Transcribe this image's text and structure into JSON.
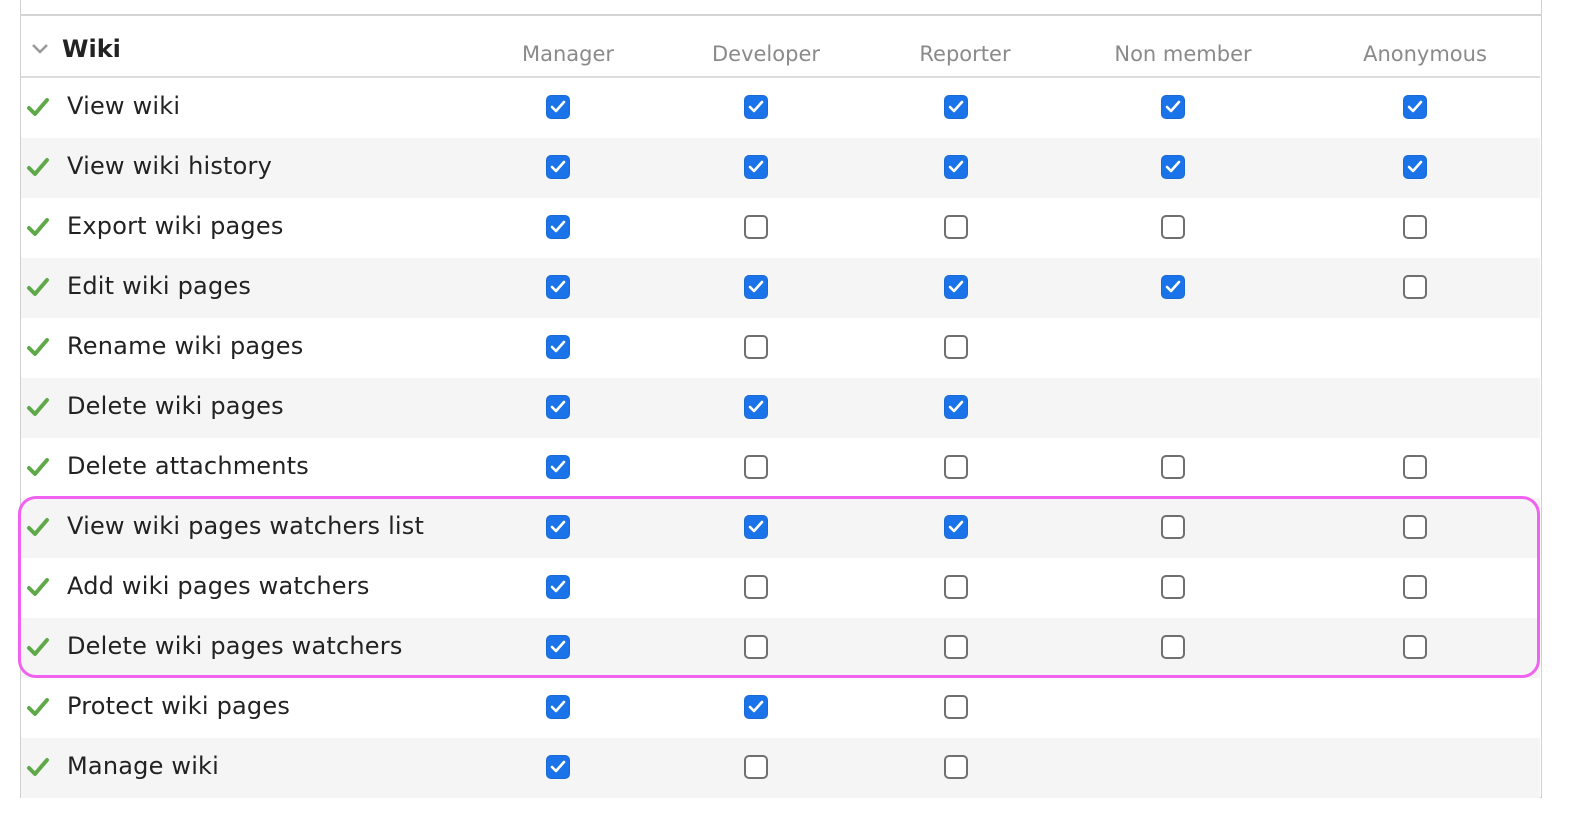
{
  "section": {
    "title": "Wiki"
  },
  "columns": [
    "Manager",
    "Developer",
    "Reporter",
    "Non member",
    "Anonymous"
  ],
  "permissions": [
    {
      "label": "View wiki",
      "values": [
        true,
        true,
        true,
        true,
        true
      ]
    },
    {
      "label": "View wiki history",
      "values": [
        true,
        true,
        true,
        true,
        true
      ]
    },
    {
      "label": "Export wiki pages",
      "values": [
        true,
        false,
        false,
        false,
        false
      ]
    },
    {
      "label": "Edit wiki pages",
      "values": [
        true,
        true,
        true,
        true,
        false
      ]
    },
    {
      "label": "Rename wiki pages",
      "values": [
        true,
        false,
        false,
        null,
        null
      ]
    },
    {
      "label": "Delete wiki pages",
      "values": [
        true,
        true,
        true,
        null,
        null
      ]
    },
    {
      "label": "Delete attachments",
      "values": [
        true,
        false,
        false,
        false,
        false
      ]
    },
    {
      "label": "View wiki pages watchers list",
      "values": [
        true,
        true,
        true,
        false,
        false
      ]
    },
    {
      "label": "Add wiki pages watchers",
      "values": [
        true,
        false,
        false,
        false,
        false
      ]
    },
    {
      "label": "Delete wiki pages watchers",
      "values": [
        true,
        false,
        false,
        false,
        false
      ]
    },
    {
      "label": "Protect wiki pages",
      "values": [
        true,
        true,
        false,
        null,
        null
      ]
    },
    {
      "label": "Manage wiki",
      "values": [
        true,
        false,
        false,
        null,
        null
      ]
    }
  ],
  "highlight": {
    "rows": [
      7,
      9
    ],
    "color": "#f062f0"
  },
  "colors": {
    "checked": "#1a73e8",
    "check_icon": "#5fa94a",
    "alt_row": "#f5f5f5"
  }
}
